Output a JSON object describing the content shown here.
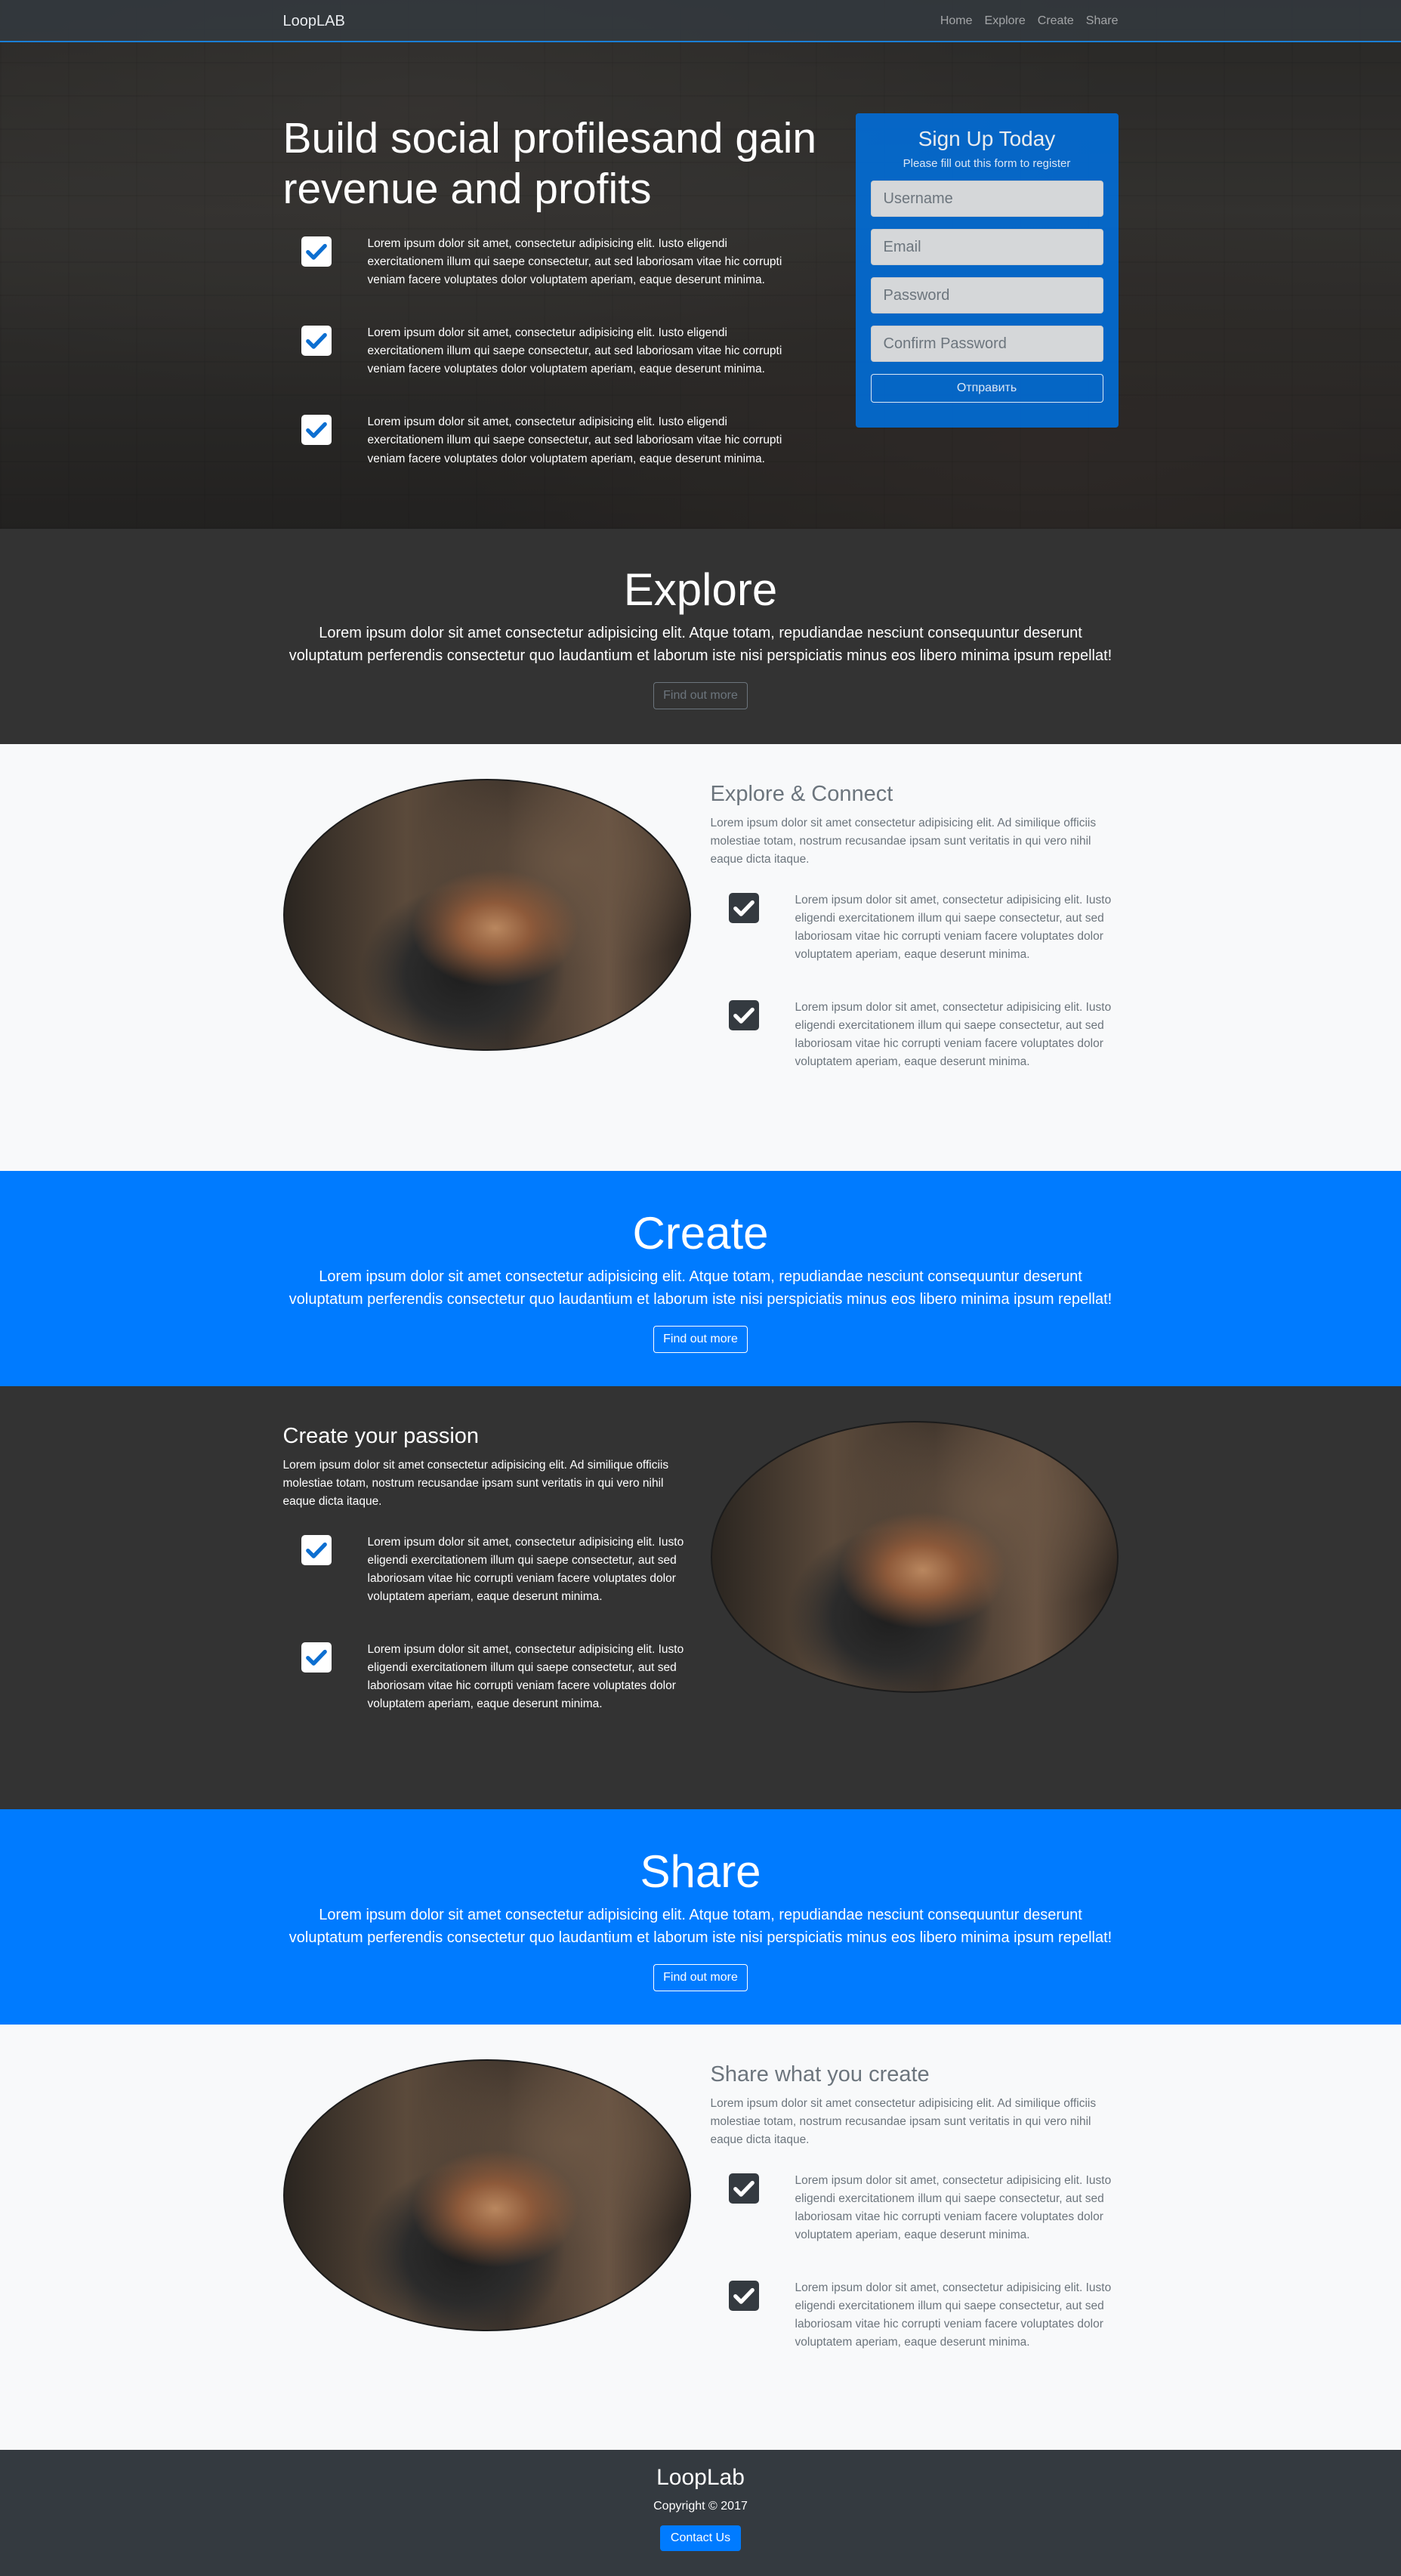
{
  "navbar": {
    "brand": "LoopLAB",
    "links": [
      "Home",
      "Explore",
      "Create",
      "Share"
    ]
  },
  "hero": {
    "title": "Build social profilesand gain revenue and profits",
    "features": [
      "Lorem ipsum dolor sit amet, consectetur adipisicing elit. Iusto eligendi exercitationem illum qui saepe consectetur, aut sed laboriosam vitae hic corrupti veniam facere voluptates dolor voluptatem aperiam, eaque deserunt minima.",
      "Lorem ipsum dolor sit amet, consectetur adipisicing elit. Iusto eligendi exercitationem illum qui saepe consectetur, aut sed laboriosam vitae hic corrupti veniam facere voluptates dolor voluptatem aperiam, eaque deserunt minima.",
      "Lorem ipsum dolor sit amet, consectetur adipisicing elit. Iusto eligendi exercitationem illum qui saepe consectetur, aut sed laboriosam vitae hic corrupti veniam facere voluptates dolor voluptatem aperiam, eaque deserunt minima."
    ]
  },
  "signup": {
    "title": "Sign Up Today",
    "subtitle": "Please fill out this form to register",
    "username_placeholder": "Username",
    "email_placeholder": "Email",
    "password_placeholder": "Password",
    "confirm_placeholder": "Confirm Password",
    "submit_label": "Отправить"
  },
  "explore": {
    "title": "Explore",
    "lead": "Lorem ipsum dolor sit amet consectetur adipisicing elit. Atque totam, repudiandae nesciunt consequuntur deserunt voluptatum perferendis consectetur quo laudantium et laborum iste nisi perspiciatis minus eos libero minima ipsum repellat!",
    "button": "Find out more"
  },
  "explore_connect": {
    "title": "Explore & Connect",
    "desc": "Lorem ipsum dolor sit amet consectetur adipisicing elit. Ad similique officiis molestiae totam, nostrum recusandae ipsam sunt veritatis in qui vero nihil eaque dicta itaque.",
    "features": [
      "Lorem ipsum dolor sit amet, consectetur adipisicing elit. Iusto eligendi exercitationem illum qui saepe consectetur, aut sed laboriosam vitae hic corrupti veniam facere voluptates dolor voluptatem aperiam, eaque deserunt minima.",
      "Lorem ipsum dolor sit amet, consectetur adipisicing elit. Iusto eligendi exercitationem illum qui saepe consectetur, aut sed laboriosam vitae hic corrupti veniam facere voluptates dolor voluptatem aperiam, eaque deserunt minima."
    ]
  },
  "create": {
    "title": "Create",
    "lead": "Lorem ipsum dolor sit amet consectetur adipisicing elit. Atque totam, repudiandae nesciunt consequuntur deserunt voluptatum perferendis consectetur quo laudantium et laborum iste nisi perspiciatis minus eos libero minima ipsum repellat!",
    "button": "Find out more"
  },
  "create_passion": {
    "title": "Create your passion",
    "desc": "Lorem ipsum dolor sit amet consectetur adipisicing elit. Ad similique officiis molestiae totam, nostrum recusandae ipsam sunt veritatis in qui vero nihil eaque dicta itaque.",
    "features": [
      "Lorem ipsum dolor sit amet, consectetur adipisicing elit. Iusto eligendi exercitationem illum qui saepe consectetur, aut sed laboriosam vitae hic corrupti veniam facere voluptates dolor voluptatem aperiam, eaque deserunt minima.",
      "Lorem ipsum dolor sit amet, consectetur adipisicing elit. Iusto eligendi exercitationem illum qui saepe consectetur, aut sed laboriosam vitae hic corrupti veniam facere voluptates dolor voluptatem aperiam, eaque deserunt minima."
    ]
  },
  "share": {
    "title": "Share",
    "lead": "Lorem ipsum dolor sit amet consectetur adipisicing elit. Atque totam, repudiandae nesciunt consequuntur deserunt voluptatum perferendis consectetur quo laudantium et laborum iste nisi perspiciatis minus eos libero minima ipsum repellat!",
    "button": "Find out more"
  },
  "share_create": {
    "title": "Share what you create",
    "desc": "Lorem ipsum dolor sit amet consectetur adipisicing elit. Ad similique officiis molestiae totam, nostrum recusandae ipsam sunt veritatis in qui vero nihil eaque dicta itaque.",
    "features": [
      "Lorem ipsum dolor sit amet, consectetur adipisicing elit. Iusto eligendi exercitationem illum qui saepe consectetur, aut sed laboriosam vitae hic corrupti veniam facere voluptates dolor voluptatem aperiam, eaque deserunt minima.",
      "Lorem ipsum dolor sit amet, consectetur adipisicing elit. Iusto eligendi exercitationem illum qui saepe consectetur, aut sed laboriosam vitae hic corrupti veniam facere voluptates dolor voluptatem aperiam, eaque deserunt minima."
    ]
  },
  "footer": {
    "brand": "LoopLab",
    "copyright": "Copyright © 2017",
    "button": "Contact Us"
  },
  "colors": {
    "primary": "#007bff",
    "dark": "#333333",
    "footer": "#343a40",
    "check_blue": "#0d6fd1"
  },
  "icons": {
    "feature_check": "check-square-icon",
    "section_image": "photo-placeholder"
  }
}
